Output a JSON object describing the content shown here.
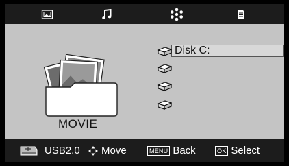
{
  "tabs": [
    {
      "name": "photo",
      "icon": "photo-icon",
      "active": false
    },
    {
      "name": "music",
      "icon": "music-note-icon",
      "active": false
    },
    {
      "name": "movie",
      "icon": "film-reel-icon",
      "active": true
    },
    {
      "name": "text",
      "icon": "document-icon",
      "active": false
    }
  ],
  "preview": {
    "label": "MOVIE",
    "icon": "folder-with-photos-icon"
  },
  "drives": [
    {
      "label": "Disk C:",
      "selected": true
    },
    {
      "label": "",
      "selected": false
    },
    {
      "label": "",
      "selected": false
    },
    {
      "label": "",
      "selected": false
    }
  ],
  "statusbar": {
    "source": "USB2.0",
    "move": "Move",
    "back_key": "MENU",
    "back": "Back",
    "select_key": "OK",
    "select": "Select"
  },
  "colors": {
    "panel": "#c4c4c4",
    "bar": "#1c1c1c",
    "text_on_bar": "#ffffff"
  }
}
